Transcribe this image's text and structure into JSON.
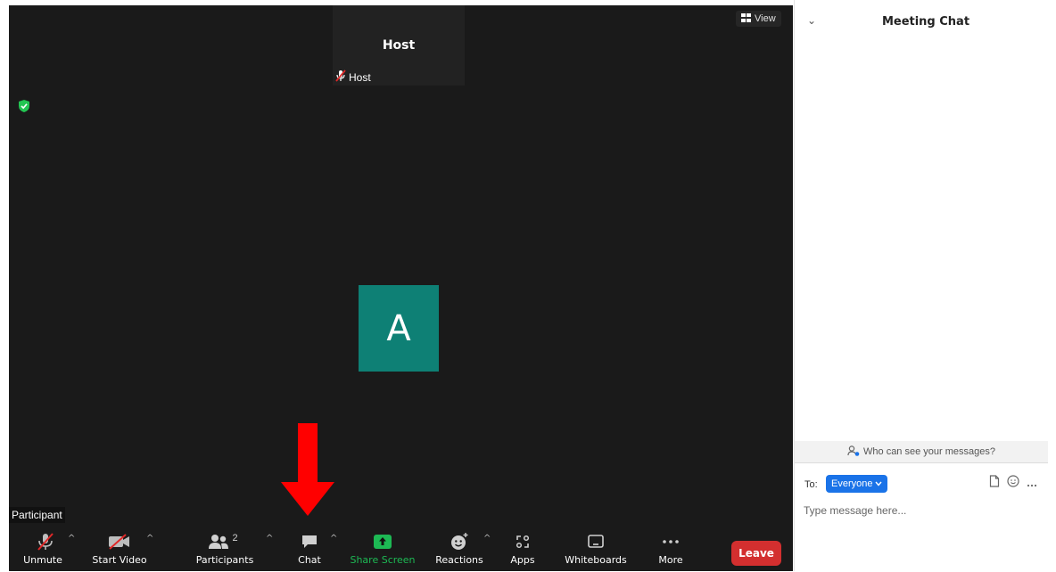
{
  "meeting": {
    "host_tile": {
      "name": "Host",
      "tag_label": "Host"
    },
    "view_button": {
      "label": "View",
      "icon": "grid-icon"
    },
    "avatar": {
      "initial": "A",
      "color": "#0e8075"
    },
    "participant_label": "Participant",
    "annotation_arrow_color": "#ff0000"
  },
  "toolbar": {
    "unmute": {
      "label": "Unmute",
      "icon": "microphone-muted-icon"
    },
    "start_video": {
      "label": "Start Video",
      "icon": "video-off-icon"
    },
    "participants": {
      "label": "Participants",
      "count": "2",
      "icon": "participants-icon"
    },
    "chat": {
      "label": "Chat",
      "icon": "chat-bubble-icon"
    },
    "share_screen": {
      "label": "Share Screen",
      "icon": "share-screen-icon",
      "color": "#1db954"
    },
    "reactions": {
      "label": "Reactions",
      "icon": "smiley-add-icon"
    },
    "apps": {
      "label": "Apps",
      "icon": "apps-icon"
    },
    "whiteboards": {
      "label": "Whiteboards",
      "icon": "whiteboard-icon"
    },
    "more": {
      "label": "More",
      "icon": "ellipsis-icon"
    },
    "leave": {
      "label": "Leave",
      "color": "#d32f2f"
    }
  },
  "chat": {
    "title": "Meeting Chat",
    "who_can_see": "Who can see your messages?",
    "to_label": "To:",
    "recipient": "Everyone",
    "placeholder": "Type message here..."
  }
}
